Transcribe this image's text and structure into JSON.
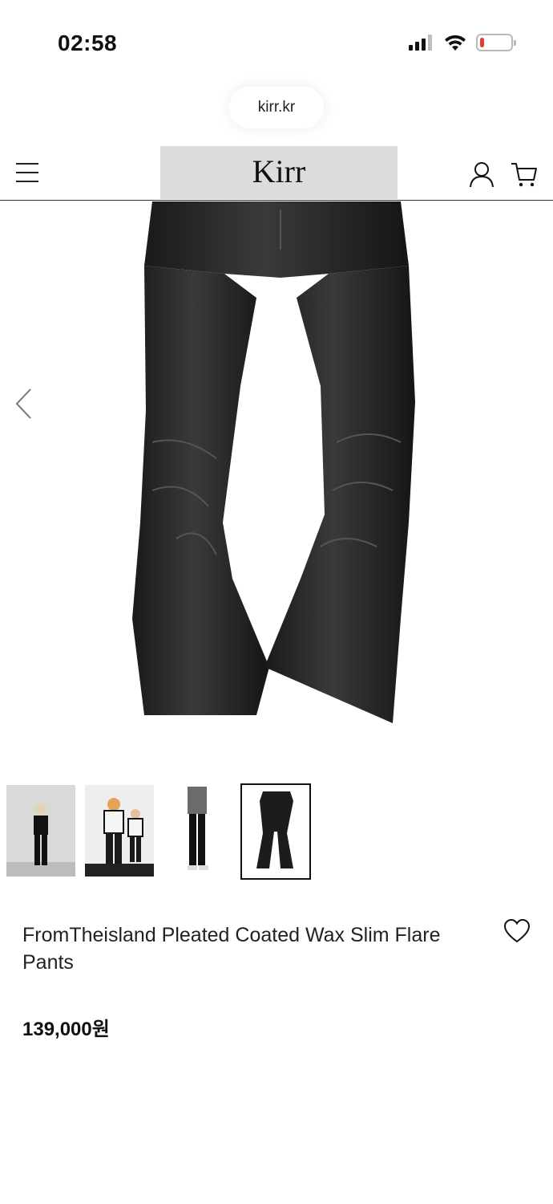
{
  "status": {
    "time": "02:58",
    "battery_percent": 15
  },
  "browser": {
    "url": "kirr.kr"
  },
  "header": {
    "logo": "Kirr"
  },
  "gallery": {
    "image_count": 4,
    "selected_index": 3
  },
  "product": {
    "title": "FromTheisland Pleated Coated Wax Slim Flare Pants",
    "price": "139,000원"
  },
  "colors": {
    "header_highlight": "#dcdcdc",
    "battery_low": "#e53935",
    "text": "#111111"
  }
}
